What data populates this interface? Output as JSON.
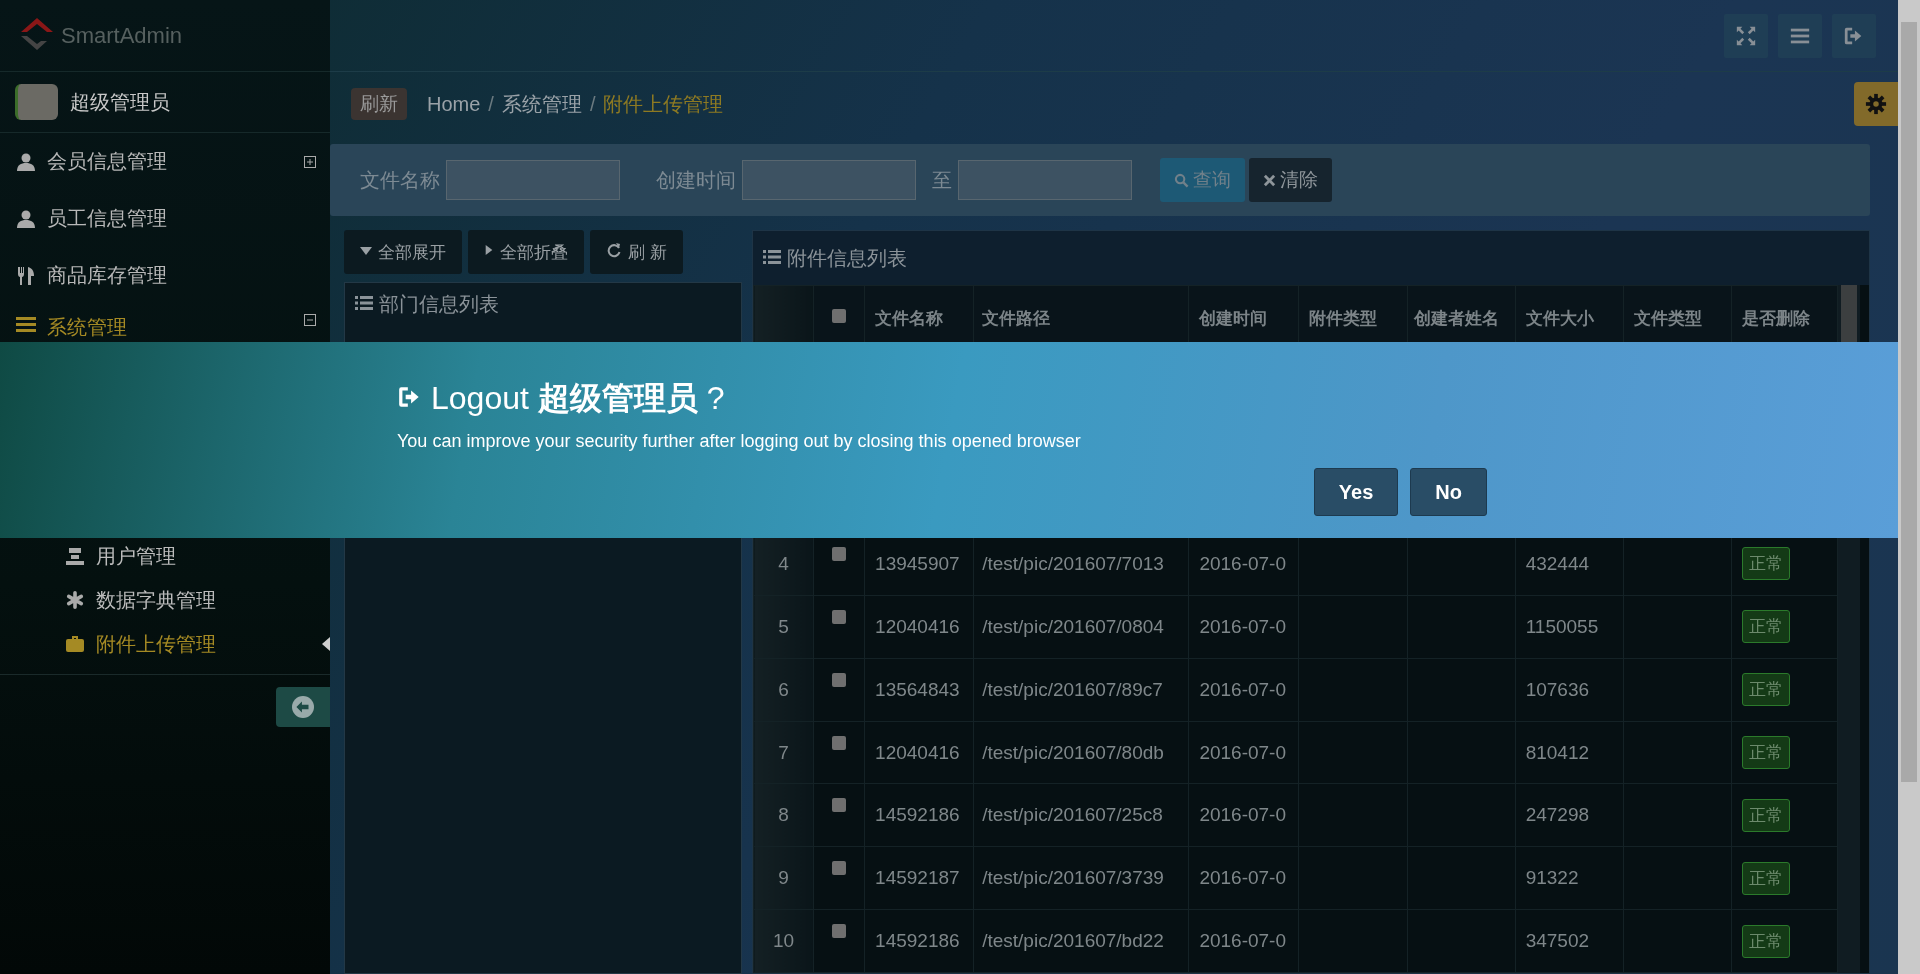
{
  "header": {
    "logo": "SmartAdmin"
  },
  "sidebar": {
    "user": "超级管理员",
    "items": [
      {
        "label": "会员信息管理",
        "kind": "user",
        "expanded": false,
        "selected": false
      },
      {
        "label": "员工信息管理",
        "kind": "user",
        "selected": false
      },
      {
        "label": "商品库存管理",
        "kind": "cutlery",
        "selected": false
      },
      {
        "label": "系统管理",
        "kind": "list",
        "expanded": true,
        "selected": true,
        "children": [
          {
            "label": "用户管理",
            "kind": "group",
            "selected": false
          },
          {
            "label": "数据字典管理",
            "kind": "asterisk",
            "selected": false
          },
          {
            "label": "附件上传管理",
            "kind": "briefcase",
            "selected": true
          }
        ]
      }
    ]
  },
  "breadcrumb": {
    "refresh": "刷新",
    "separator": "/",
    "items": [
      "Home",
      "系统管理",
      "附件上传管理"
    ]
  },
  "filter": {
    "name_label": "文件名称",
    "time_label": "创建时间",
    "to_label": "至",
    "search_button": "查询",
    "clear_button": "清除"
  },
  "toolbar": [
    {
      "label": "全部展开",
      "kind": "down"
    },
    {
      "label": "全部折叠",
      "kind": "right"
    },
    {
      "label": "刷 新",
      "kind": "refresh"
    }
  ],
  "dept_panel": {
    "title": "部门信息列表"
  },
  "table": {
    "title": "附件信息列表",
    "select_all_checked": false,
    "columns": [
      "文件名称",
      "文件路径",
      "创建时间",
      "附件类型",
      "创建者姓名",
      "文件大小",
      "文件类型",
      "是否删除"
    ],
    "rows": [
      {
        "index": "4",
        "checked": false,
        "name": "13945907",
        "path": "/test/pic/201607/7013",
        "time": "2016-07-0",
        "size": "432444",
        "status": "正常"
      },
      {
        "index": "5",
        "checked": false,
        "name": "12040416",
        "path": "/test/pic/201607/0804",
        "time": "2016-07-0",
        "size": "1150055",
        "status": "正常"
      },
      {
        "index": "6",
        "checked": false,
        "name": "13564843",
        "path": "/test/pic/201607/89c7",
        "time": "2016-07-0",
        "size": "107636",
        "status": "正常"
      },
      {
        "index": "7",
        "checked": false,
        "name": "12040416",
        "path": "/test/pic/201607/80db",
        "time": "2016-07-0",
        "size": "810412",
        "status": "正常"
      },
      {
        "index": "8",
        "checked": false,
        "name": "14592186",
        "path": "/test/pic/201607/25c8",
        "time": "2016-07-0",
        "size": "247298",
        "status": "正常"
      },
      {
        "index": "9",
        "checked": false,
        "name": "14592187",
        "path": "/test/pic/201607/3739",
        "time": "2016-07-0",
        "size": "91322",
        "status": "正常"
      },
      {
        "index": "10",
        "checked": false,
        "name": "14592186",
        "path": "/test/pic/201607/bd22",
        "time": "2016-07-0",
        "size": "347502",
        "status": "正常"
      }
    ]
  },
  "dialog": {
    "title": "Logout **超级管理员** ?",
    "message": "You can improve your security further after logging out by closing this opened browser",
    "buttons": [
      "Yes",
      "No"
    ]
  }
}
